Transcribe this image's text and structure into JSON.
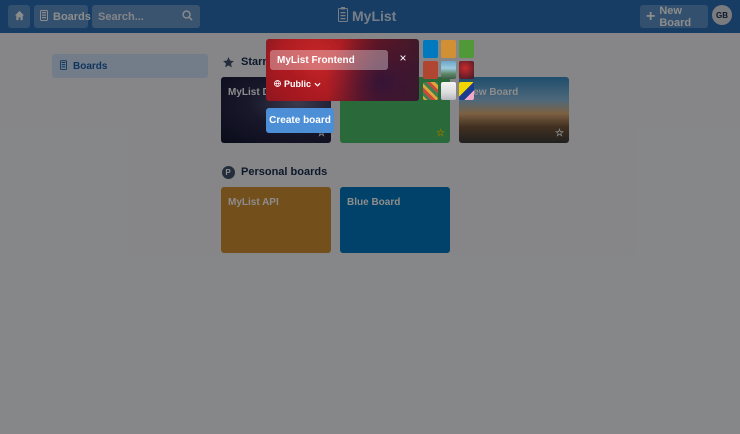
{
  "header": {
    "home_icon": "home-icon",
    "boards_label": "Boards",
    "search_placeholder": "Search...",
    "app_title": "MyList",
    "new_board_label": "New Board",
    "avatar_initials": "GB"
  },
  "sidebar": {
    "items": [
      {
        "label": "Boards",
        "icon": "board-icon"
      }
    ]
  },
  "sections": {
    "starred": {
      "title": "Starred boards"
    },
    "personal": {
      "title": "Personal boards",
      "badge": "P"
    }
  },
  "starred_boards": [
    {
      "name": "MyList Dev",
      "starred": true
    },
    {
      "name": "",
      "starred": true
    },
    {
      "name": "New Board",
      "starred": true
    }
  ],
  "personal_boards": [
    {
      "name": "MyList API"
    },
    {
      "name": "Blue Board"
    }
  ],
  "create_popup": {
    "title_value": "MyList Frontend",
    "visibility": "Public",
    "create_label": "Create board",
    "close_glyph": "×",
    "swatches": [
      {
        "type": "color",
        "value": "#0079bf"
      },
      {
        "type": "color",
        "value": "#d29034"
      },
      {
        "type": "color",
        "value": "#519839"
      },
      {
        "type": "color",
        "value": "#b04632"
      },
      {
        "type": "photo",
        "value": "landscape"
      },
      {
        "type": "photo",
        "value": "red-abstract"
      },
      {
        "type": "photo",
        "value": "colorful-pattern"
      },
      {
        "type": "photo",
        "value": "white-desk"
      },
      {
        "type": "photo",
        "value": "yellow-abstract"
      }
    ]
  },
  "colors": {
    "header": "#2a6fb8",
    "accent": "#0079bf",
    "create_button": "#4d8fd6"
  }
}
